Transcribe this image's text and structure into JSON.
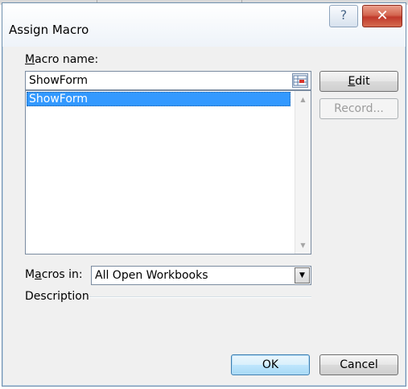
{
  "dialog": {
    "title": "Assign Macro",
    "help_icon": "question-mark-icon",
    "help_glyph": "?",
    "close_icon": "close-x-icon",
    "close_glyph": "✕"
  },
  "macro_name": {
    "label_prefix": "",
    "label_mnemonic": "M",
    "label_rest": "acro name:",
    "value": "ShowForm",
    "ref_icon": "collapse-dialog-icon"
  },
  "macro_list": {
    "items": [
      "ShowForm"
    ],
    "selected_index": 0,
    "scroll_up_glyph": "▲",
    "scroll_down_glyph": "▼"
  },
  "buttons": {
    "edit_mnemonic": "E",
    "edit_rest": "dit",
    "record": "Record...",
    "ok": "OK",
    "cancel": "Cancel"
  },
  "macros_in": {
    "label_prefix": "M",
    "label_mnemonic": "a",
    "label_rest": "cros in:",
    "value": "All Open Workbooks",
    "arrow_glyph": "▼"
  },
  "description": {
    "label": "Description"
  },
  "colors": {
    "selection": "#3399ff",
    "close_button": "#c0392b",
    "dialog_bg": "#f0f0f0"
  }
}
